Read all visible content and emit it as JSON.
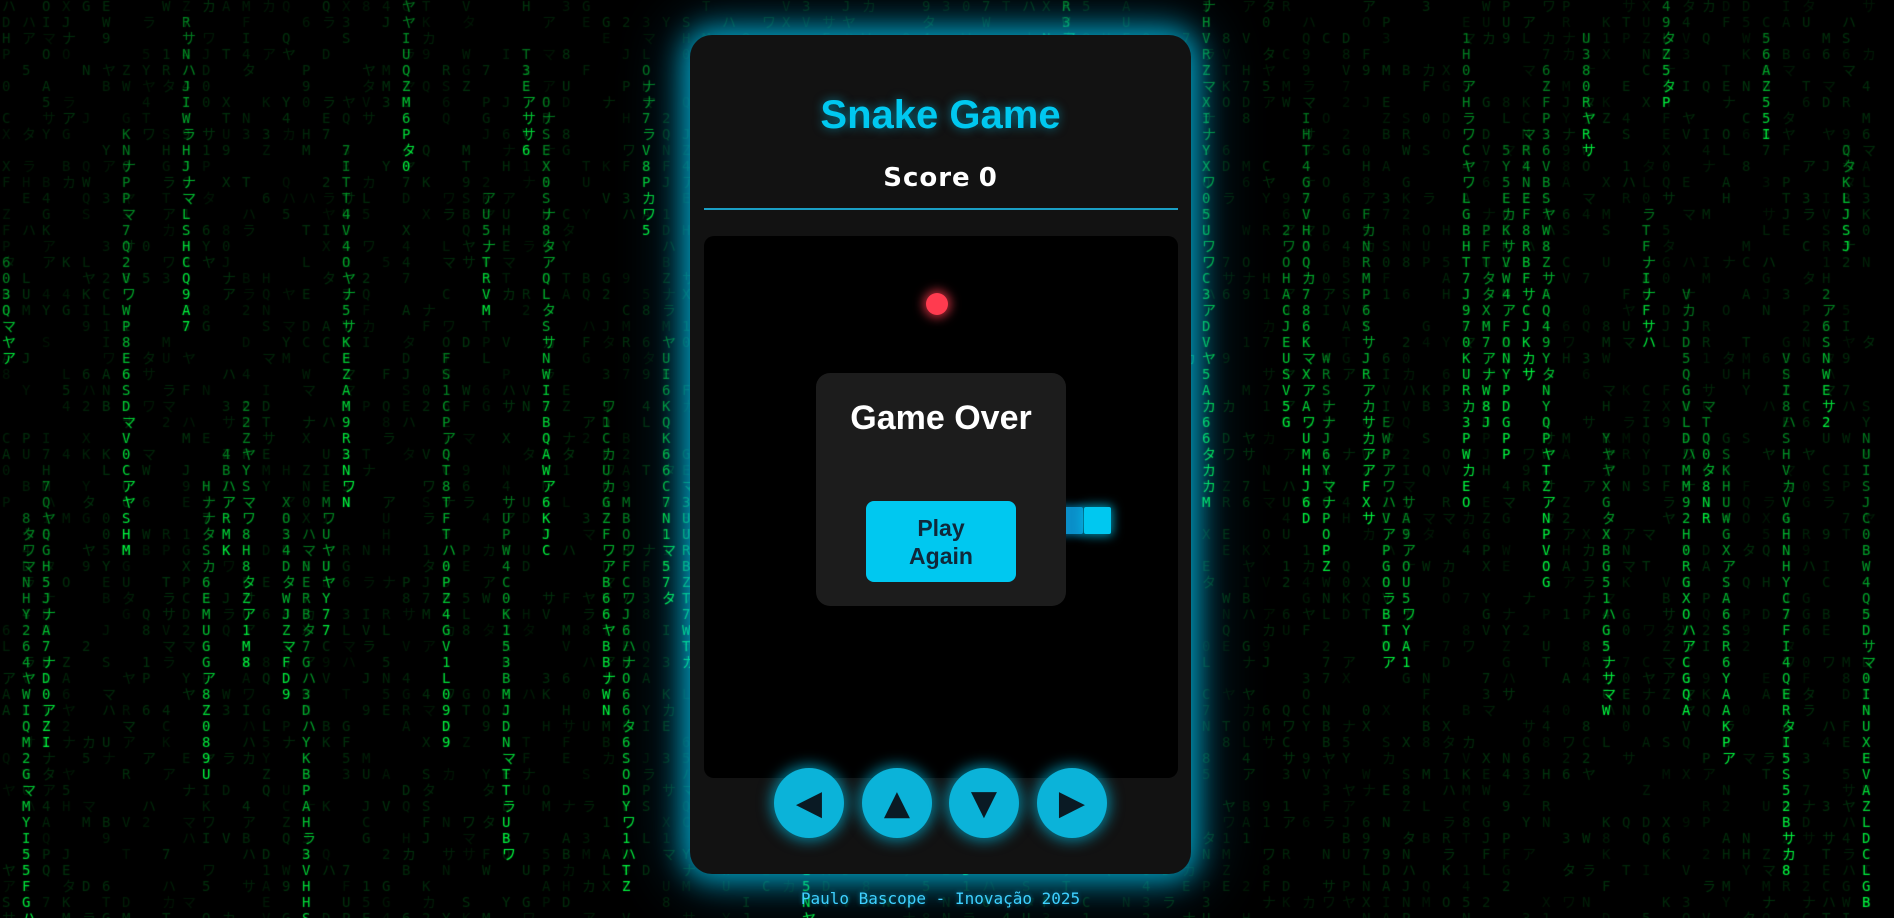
{
  "game": {
    "title": "Snake Game",
    "score_label": "Score",
    "score_value": "0",
    "overlay_title": "Game Over",
    "play_again_label": "Play Again"
  },
  "controls": {
    "left_icon": "◀",
    "up_icon": "▲",
    "down_icon": "▼",
    "right_icon": "▶"
  },
  "footer": {
    "text": "Paulo Bascope - Inovação 2025"
  },
  "colors": {
    "accent": "#00c8f0",
    "food": "#ff3b4f",
    "matrix_green": "#00ff41",
    "card_bg": "#121212"
  }
}
